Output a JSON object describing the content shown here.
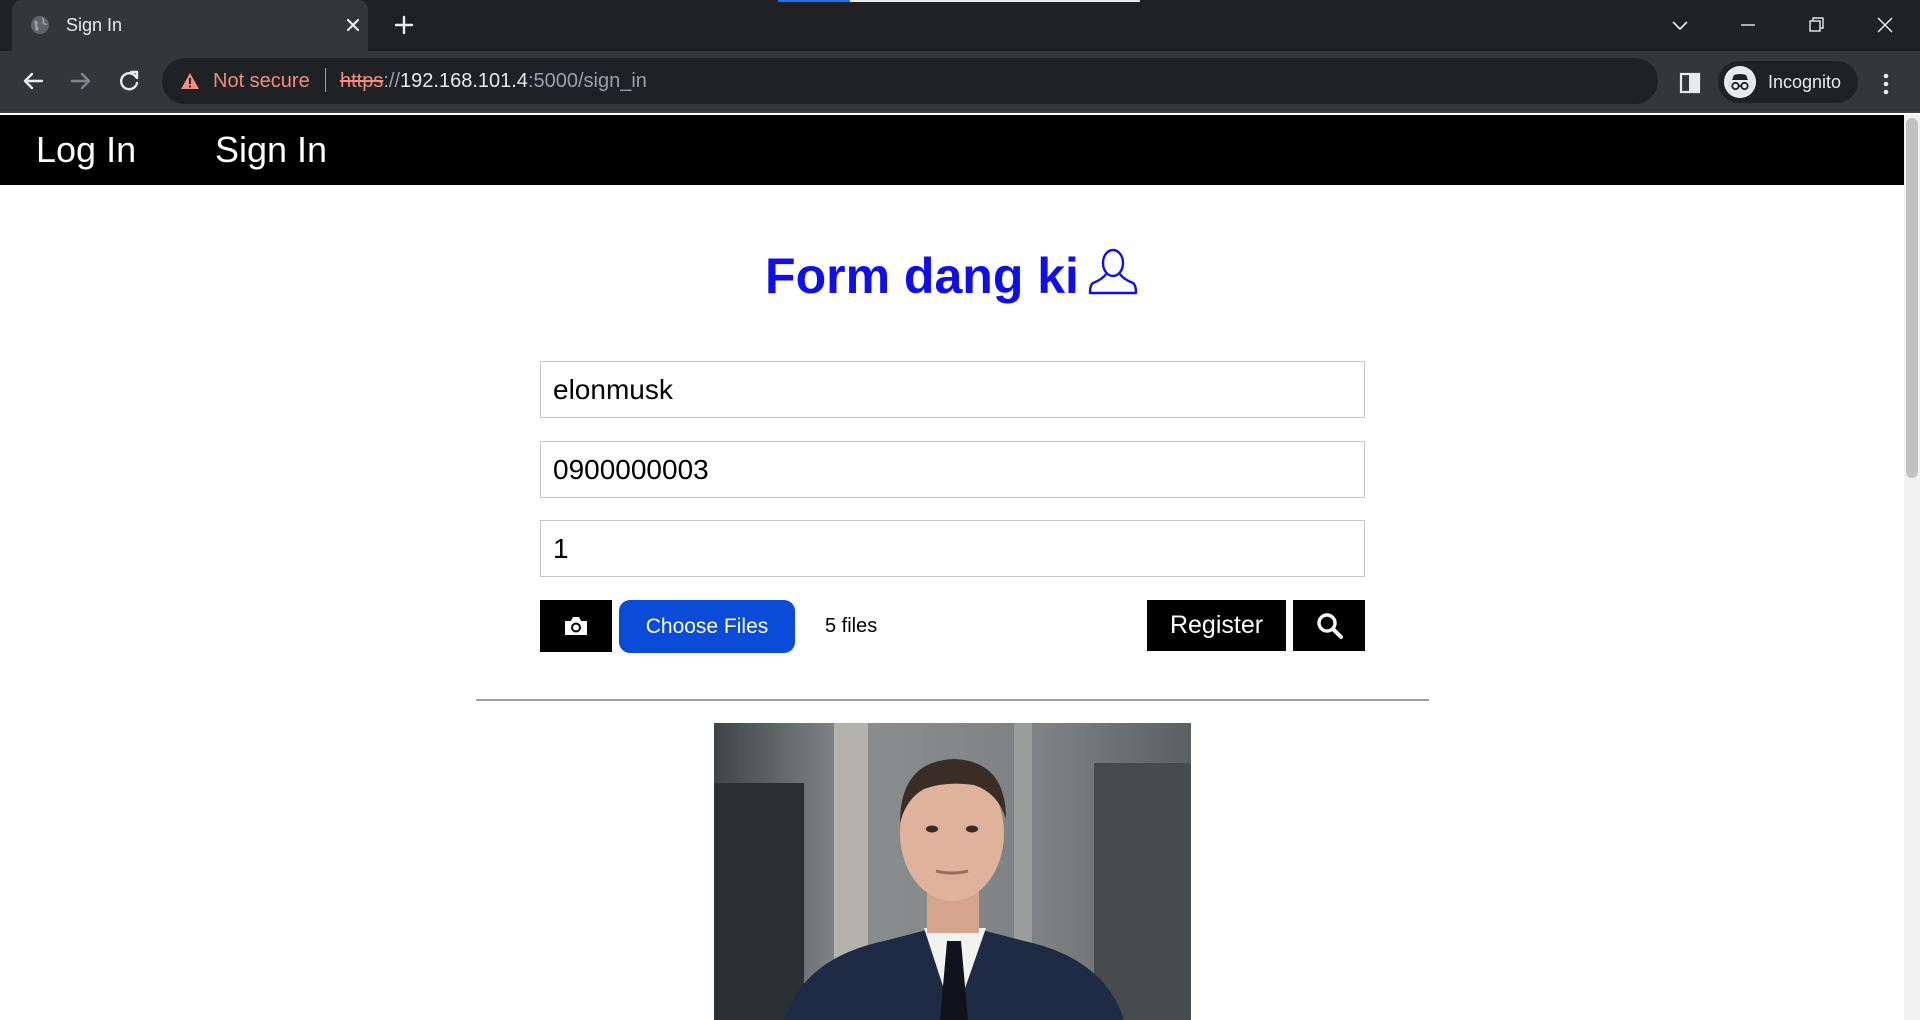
{
  "browser": {
    "tab": {
      "title": "Sign In",
      "favicon": "globe-icon"
    },
    "address_bar": {
      "security_label": "Not secure",
      "url_scheme": "https",
      "url_separator": "://",
      "url_host": "192.168.101.4",
      "url_rest": ":5000/sign_in"
    },
    "profile": {
      "label": "Incognito"
    },
    "colors": {
      "frame": "#202124",
      "toolbar": "#35363a",
      "warning": "#f28b82"
    }
  },
  "site_nav": {
    "links": [
      {
        "label": "Log In"
      },
      {
        "label": "Sign In"
      }
    ]
  },
  "form": {
    "title": "Form dang ki",
    "title_icon": "user-outline-icon",
    "title_color": "#1010e6",
    "fields": {
      "username": {
        "value": "elonmusk"
      },
      "phone": {
        "value": "0900000003"
      },
      "third": {
        "value": "1"
      }
    },
    "camera_button_icon": "camera-icon",
    "choose_files_label": "Choose Files",
    "files_status": "5 files",
    "register_label": "Register",
    "search_button_icon": "search-icon",
    "accent_color": "#0a4bd8"
  },
  "preview": {
    "image": "uploaded-portrait-photo"
  }
}
